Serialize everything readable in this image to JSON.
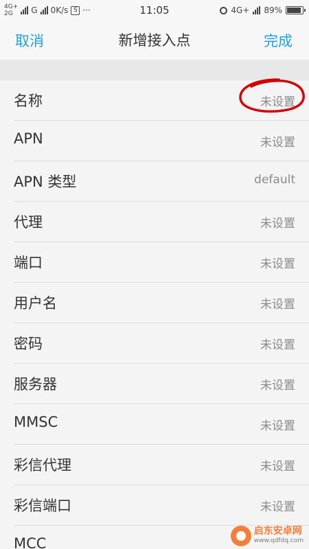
{
  "status_bar": {
    "net1": "4G+",
    "net2": "2G",
    "g_label": "G",
    "speed": "0K/s",
    "s_icon": "S",
    "more": "···",
    "time": "11:05",
    "net_right": "4G+",
    "battery": "89%",
    "battery_level": 0.89
  },
  "header": {
    "cancel": "取消",
    "title": "新增接入点",
    "done": "完成"
  },
  "rows": [
    {
      "label": "名称",
      "value": "未设置"
    },
    {
      "label": "APN",
      "value": "未设置"
    },
    {
      "label": "APN 类型",
      "value": "default"
    },
    {
      "label": "代理",
      "value": "未设置"
    },
    {
      "label": "端口",
      "value": "未设置"
    },
    {
      "label": "用户名",
      "value": "未设置"
    },
    {
      "label": "密码",
      "value": "未设置"
    },
    {
      "label": "服务器",
      "value": "未设置"
    },
    {
      "label": "MMSC",
      "value": "未设置"
    },
    {
      "label": "彩信代理",
      "value": "未设置"
    },
    {
      "label": "彩信端口",
      "value": "未设置"
    },
    {
      "label": "MCC",
      "value": ""
    }
  ],
  "colors": {
    "accent": "#22a0dc",
    "annotation": "#d40000"
  },
  "watermark": {
    "name": "启东安卓网",
    "url": "www.qdfdq.com"
  }
}
